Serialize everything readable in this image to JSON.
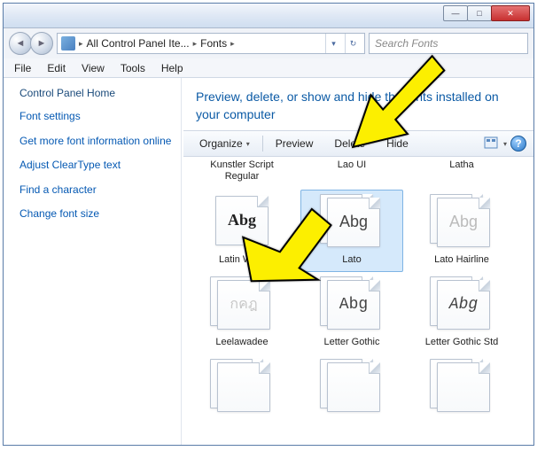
{
  "titlebar": {
    "min": "—",
    "max": "□",
    "close": "✕"
  },
  "nav": {
    "back": "◄",
    "forward": "►"
  },
  "address": {
    "crumb1": "All Control Panel Ite...",
    "crumb2": "Fonts",
    "sep": "▸",
    "dropdown": "▾",
    "refresh": "↻"
  },
  "search": {
    "placeholder": "Search Fonts"
  },
  "menu": {
    "file": "File",
    "edit": "Edit",
    "view": "View",
    "tools": "Tools",
    "help": "Help"
  },
  "sidebar": {
    "title": "Control Panel Home",
    "links": [
      "Font settings",
      "Get more font information online",
      "Adjust ClearType text",
      "Find a character",
      "Change font size"
    ]
  },
  "main": {
    "heading": "Preview, delete, or show and hide the fonts installed on your computer"
  },
  "toolbar": {
    "organize": "Organize",
    "preview": "Preview",
    "delete": "Delete",
    "hide": "Hide",
    "dropdown": "▾",
    "help": "?"
  },
  "fonts": {
    "row0": [
      {
        "label": "Kunstler Script Regular"
      },
      {
        "label": "Lao UI"
      },
      {
        "label": "Latha"
      }
    ],
    "row1": [
      {
        "label": "Latin Wide",
        "sample": "Abg"
      },
      {
        "label": "Lato",
        "sample": "Abg"
      },
      {
        "label": "Lato Hairline",
        "sample": "Abg"
      }
    ],
    "row2": [
      {
        "label": "Leelawadee",
        "sample": "กคฎ"
      },
      {
        "label": "Letter Gothic",
        "sample": "Abg"
      },
      {
        "label": "Letter Gothic Std",
        "sample": "Abg"
      }
    ]
  }
}
